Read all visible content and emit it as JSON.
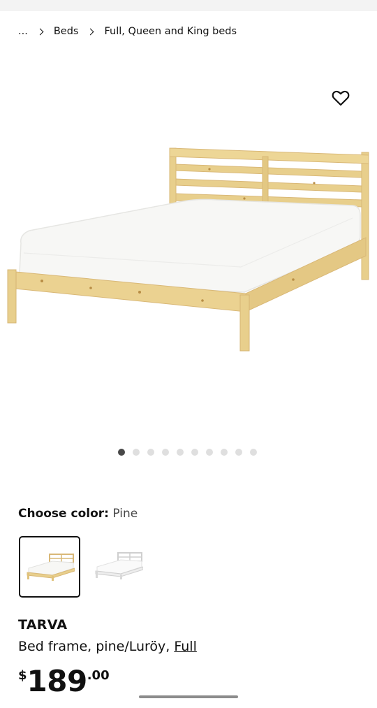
{
  "breadcrumb": {
    "ellipsis": "...",
    "items": [
      "Beds",
      "Full, Queen and King beds"
    ]
  },
  "favorite": {
    "icon": "heart-outline-icon"
  },
  "gallery": {
    "image_count": 10,
    "active_index": 0
  },
  "color": {
    "label": "Choose color:",
    "value": "Pine",
    "options": [
      "Pine",
      "White"
    ]
  },
  "product": {
    "name": "TARVA",
    "description": "Bed frame, pine/Luröy,",
    "size": "Full",
    "price": {
      "currency": "$",
      "integer": "189",
      "decimal": ".00"
    }
  },
  "colors": {
    "pine": "#e8cf8c",
    "pine_dark": "#c8a55a",
    "mattress": "#f7f7f5",
    "active_dot": "#484848",
    "inactive_dot": "#dfdfdf"
  }
}
